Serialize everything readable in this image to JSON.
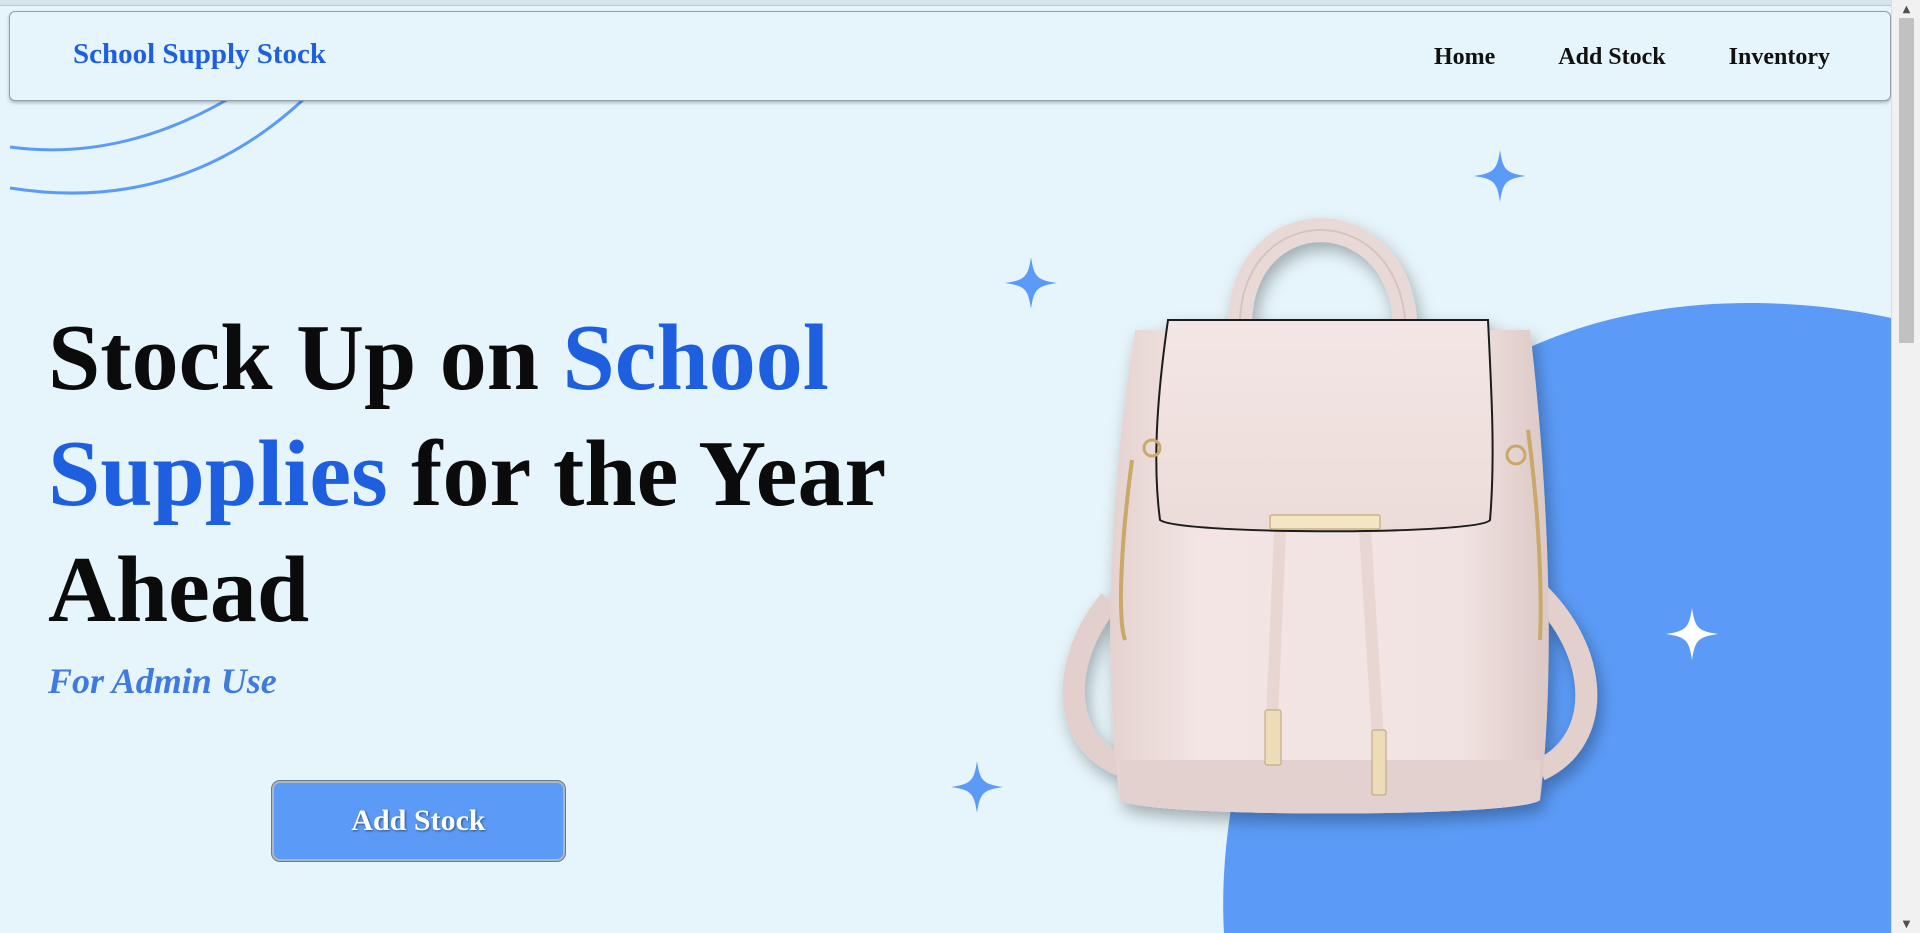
{
  "navbar": {
    "brand": "School Supply Stock",
    "links": [
      "Home",
      "Add Stock",
      "Inventory"
    ]
  },
  "hero": {
    "title_part1": "Stock Up on ",
    "title_accent": "School Supplies",
    "title_part2": " for the Year Ahead",
    "subtitle": "For Admin Use",
    "cta_label": "Add Stock"
  },
  "colors": {
    "background": "#e6f5fb",
    "accent": "#1e5fe0",
    "button": "#5b9bf7",
    "blob": "#5b9bf7",
    "backpack": "#f1e3e1"
  },
  "icons": [
    "sparkle-icon",
    "backpack-image",
    "scroll-up-icon",
    "scroll-down-icon"
  ]
}
